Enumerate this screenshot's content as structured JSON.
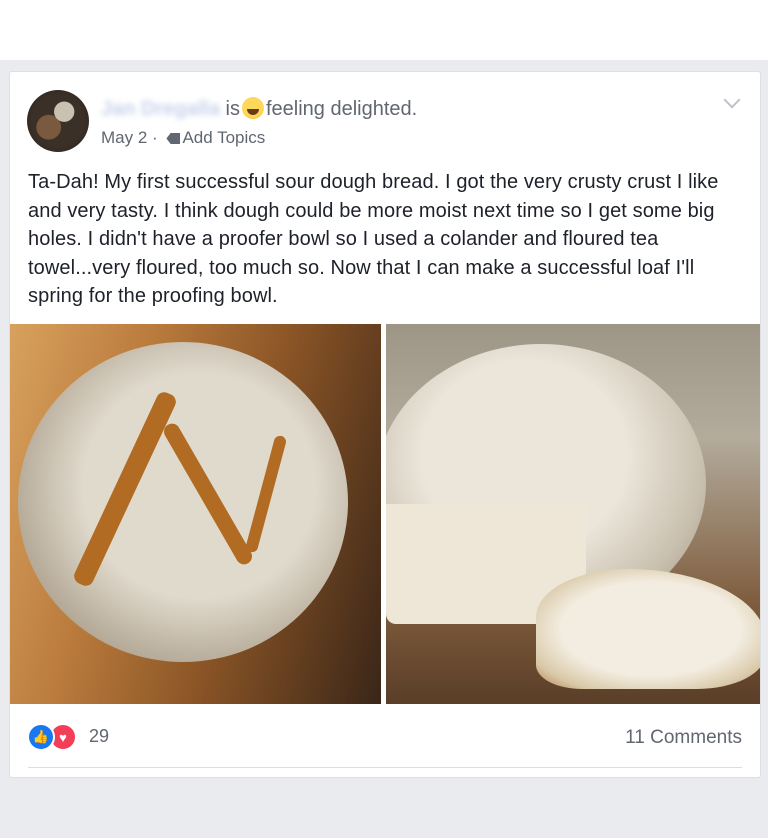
{
  "post": {
    "author_name": "Jan Dregalla",
    "author_suffix": "is",
    "feeling_emoji": "😆",
    "feeling_text": "feeling delighted.",
    "date": "May 2",
    "separator": "·",
    "add_topics": "Add Topics",
    "body": "Ta-Dah! My first successful sour dough bread. I got the very crusty crust I like and very tasty. I think dough could be more moist next time so I get some big holes. I didn't have a proofer bowl so I used a colander and floured tea towel...very floured, too much so. Now that I can make a successful loaf I'll spring for the proofing bowl."
  },
  "reactions": {
    "like_icon": "thumbs-up-icon",
    "love_icon": "heart-icon",
    "count": "29"
  },
  "comments": {
    "label": "11 Comments"
  },
  "colors": {
    "background": "#e9ebee",
    "card": "#ffffff",
    "text": "#1d2129",
    "muted": "#616770",
    "like": "#1877f2",
    "love": "#f33e58"
  }
}
